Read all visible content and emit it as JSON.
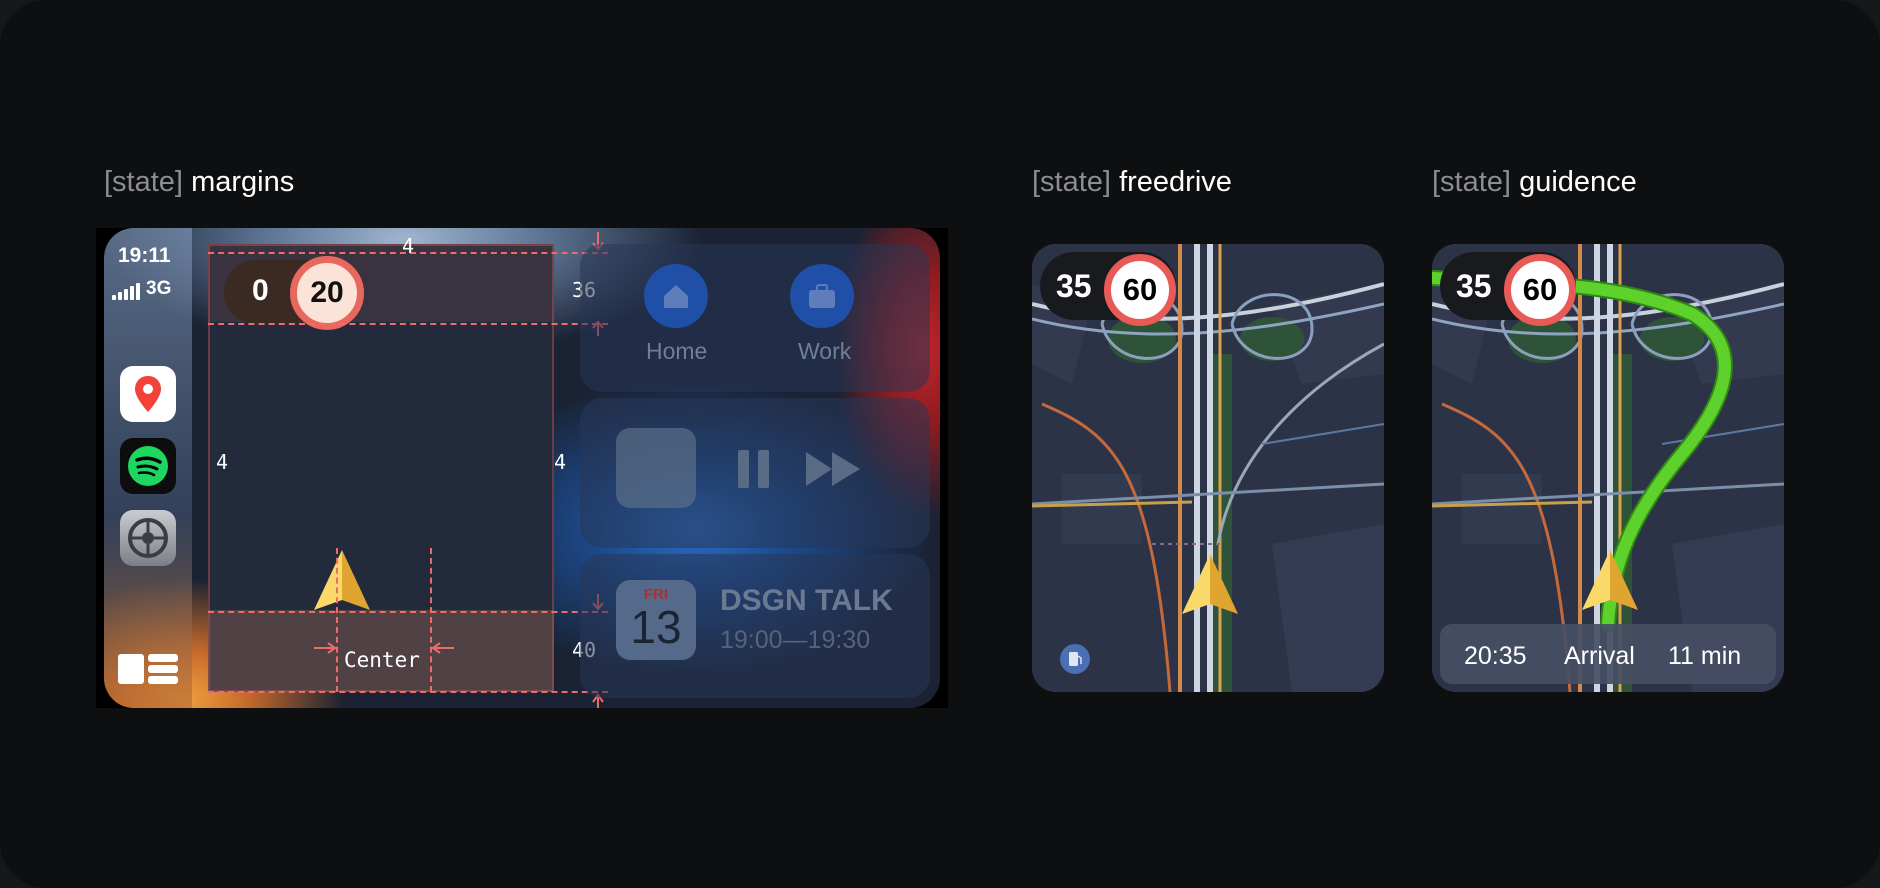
{
  "headings": {
    "margins": {
      "tag": "[state]",
      "name": "margins"
    },
    "freedrive": {
      "tag": "[state]",
      "name": "freedrive"
    },
    "guidence": {
      "tag": "[state]",
      "name": "guidence"
    }
  },
  "carplay": {
    "status": {
      "time": "19:11",
      "network": "3G"
    },
    "apps": [
      "maps-icon",
      "spotify-icon",
      "settings-icon"
    ],
    "speed": {
      "current": "0",
      "limit": "20"
    },
    "margins": {
      "top": "4",
      "left": "4",
      "right": "4",
      "top_band": "36",
      "bottom_band": "40",
      "center": "Center"
    },
    "favorites": [
      {
        "label": "Home",
        "icon": "house-icon"
      },
      {
        "label": "Work",
        "icon": "briefcase-icon"
      }
    ],
    "calendar": {
      "day": "FRI",
      "date": "13",
      "title": "DSGN TALK",
      "time": "19:00—19:30"
    }
  },
  "freedrive": {
    "speed": {
      "current": "35",
      "limit": "60"
    }
  },
  "guidence": {
    "speed": {
      "current": "35",
      "limit": "60"
    },
    "eta": {
      "time": "20:35",
      "label": "Arrival",
      "duration": "11 min"
    }
  },
  "colors": {
    "background": "#0e0f11",
    "accent_red": "#e8685e",
    "route_green": "#5fd12c",
    "arrow_gold": "#f5c13a"
  }
}
